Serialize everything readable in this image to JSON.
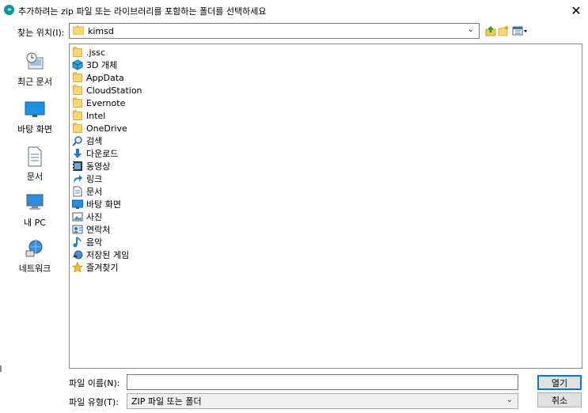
{
  "window": {
    "title": "추가하려는 zip 파일 또는 라이브러리를 포함하는 폴더를 선택하세요",
    "close_label": "✕"
  },
  "lookin": {
    "label": "찾는 위치(I):",
    "value": "kimsd"
  },
  "places": [
    {
      "label": "최근 문서",
      "icon": "recent-icon"
    },
    {
      "label": "바탕 화면",
      "icon": "desktop-icon"
    },
    {
      "label": "문서",
      "icon": "documents-icon"
    },
    {
      "label": "내 PC",
      "icon": "pc-icon"
    },
    {
      "label": "네트워크",
      "icon": "network-icon"
    }
  ],
  "files": [
    {
      "name": ".jssc",
      "icon": "folder-icon"
    },
    {
      "name": "3D 개체",
      "icon": "3d-objects-icon"
    },
    {
      "name": "AppData",
      "icon": "folder-icon"
    },
    {
      "name": "CloudStation",
      "icon": "folder-icon"
    },
    {
      "name": "Evernote",
      "icon": "folder-icon"
    },
    {
      "name": "Intel",
      "icon": "folder-icon"
    },
    {
      "name": "OneDrive",
      "icon": "folder-icon"
    },
    {
      "name": "검색",
      "icon": "search-icon"
    },
    {
      "name": "다운로드",
      "icon": "downloads-icon"
    },
    {
      "name": "동영상",
      "icon": "videos-icon"
    },
    {
      "name": "링크",
      "icon": "links-icon"
    },
    {
      "name": "문서",
      "icon": "documents-icon"
    },
    {
      "name": "바탕 화면",
      "icon": "desktop-icon"
    },
    {
      "name": "사진",
      "icon": "pictures-icon"
    },
    {
      "name": "연락처",
      "icon": "contacts-icon"
    },
    {
      "name": "음악",
      "icon": "music-icon"
    },
    {
      "name": "저장된 게임",
      "icon": "saved-games-icon"
    },
    {
      "name": "즐겨찾기",
      "icon": "favorites-icon"
    }
  ],
  "filename": {
    "label": "파일 이름(N):",
    "value": ""
  },
  "filetype": {
    "label": "파일 유형(T):",
    "value": "ZIP 파일 또는 폴더"
  },
  "buttons": {
    "open": "열기",
    "cancel": "취소"
  },
  "colors": {
    "accent": "#0078d7",
    "folder": "#f7d774",
    "app_icon": "#00979d"
  }
}
